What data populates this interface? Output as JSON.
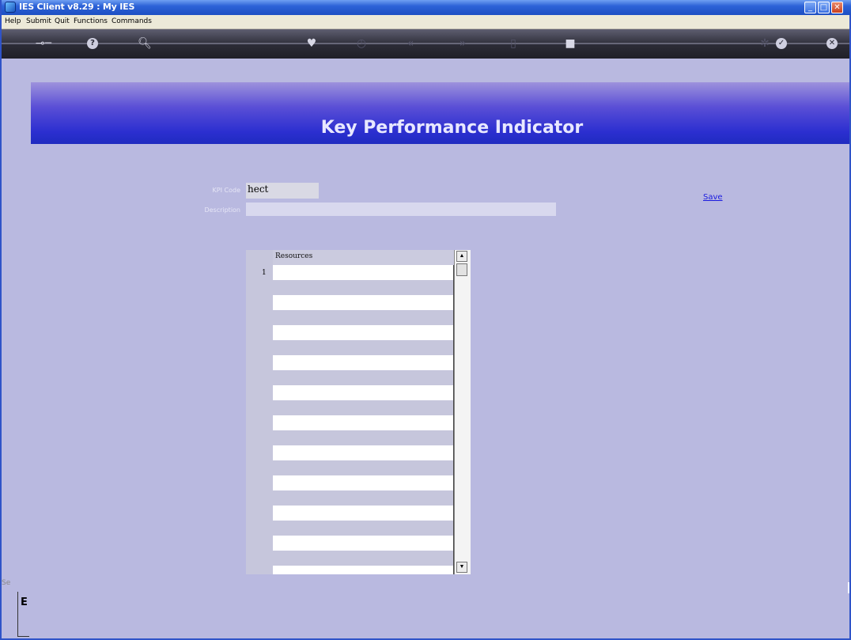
{
  "window": {
    "title": "IES Client v8.29 : My IES",
    "controls": {
      "minimize": "_",
      "maximize": "□",
      "close": "✕"
    }
  },
  "menu": [
    "Help",
    "Submit",
    "Quit",
    "Functions",
    "Commands"
  ],
  "toolbar": {
    "icons": [
      "key-icon",
      "help-icon",
      "search-icon",
      "heart-icon",
      "clock-icon",
      "rewind-icon",
      "forward-icon",
      "trash-icon",
      "stop-icon",
      "settings-icon",
      "ok-icon",
      "cancel-icon"
    ]
  },
  "page": {
    "title": "Key Performance Indicator"
  },
  "form": {
    "kpi_code_label": "KPI Code",
    "kpi_code_value": "hect",
    "description_label": "Description",
    "description_value": "",
    "save_label": "Save"
  },
  "grid": {
    "header": "Resources",
    "row_number": "1"
  },
  "footer": {
    "clipped_label": "Se",
    "clipped_char": "E"
  }
}
